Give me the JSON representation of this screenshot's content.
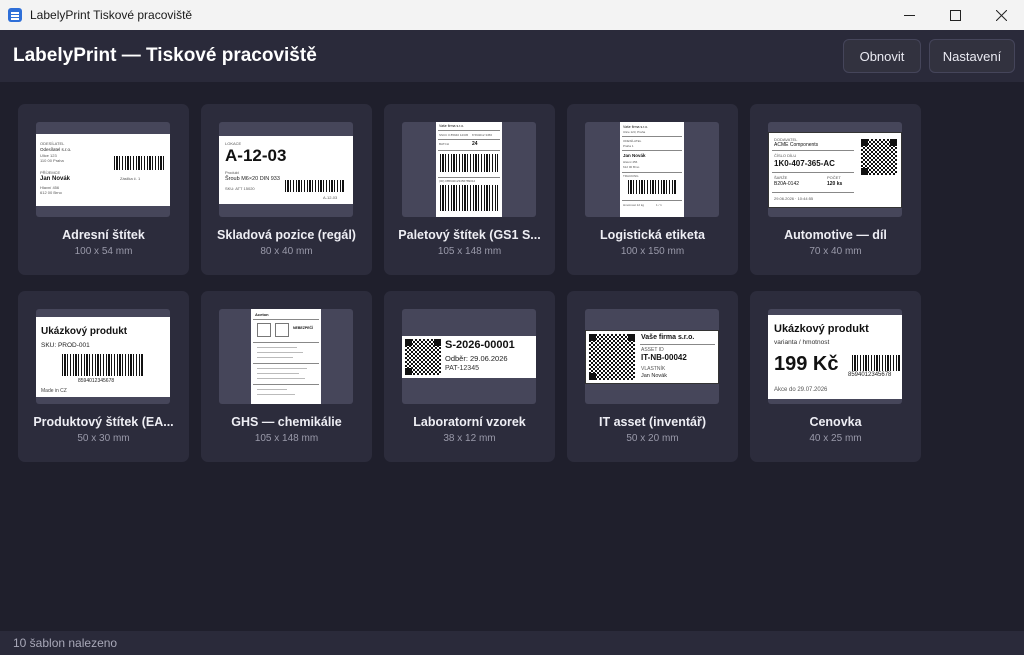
{
  "window": {
    "title": "LabelyPrint Tiskové pracoviště"
  },
  "header": {
    "title": "LabelyPrint — Tiskové pracoviště",
    "refresh_label": "Obnovit",
    "settings_label": "Nastavení"
  },
  "templates": [
    {
      "name": "Adresní štítek",
      "size": "100 x 54 mm",
      "preview": {
        "sender_company": "Odesílatel s.r.o.",
        "recipient_name": "Jan Novák"
      }
    },
    {
      "name": "Skladová pozice (regál)",
      "size": "80 x 40 mm",
      "preview": {
        "code": "A-12-03",
        "line": "Šroub M6×20 DIN 933"
      }
    },
    {
      "name": "Paletový štítek (GS1 S...",
      "size": "105 x 148 mm",
      "preview": {
        "qty": "24"
      }
    },
    {
      "name": "Logistická etiketa",
      "size": "100 x 150 mm",
      "preview": {
        "recipient": "Jan Novák"
      }
    },
    {
      "name": "Automotive — díl",
      "size": "70 x 40 mm",
      "preview": {
        "supplier": "ACME Components",
        "part": "1K0-407-365-AC",
        "batch": "B20A-0142",
        "qty": "120 ks"
      }
    },
    {
      "name": "Produktový štítek (EA...",
      "size": "50 x 30 mm",
      "preview": {
        "product": "Ukázkový produkt",
        "sku": "SKU: PROD-001",
        "ean": "8594012345678",
        "origin": "Made in CZ"
      }
    },
    {
      "name": "GHS — chemikálie",
      "size": "105 x 148 mm",
      "preview": {
        "substance": "Aceton",
        "signal": "NEBEZPEČÍ"
      }
    },
    {
      "name": "Laboratorní vzorek",
      "size": "38 x 12 mm",
      "preview": {
        "sample_id": "S-2026-00001",
        "taken": "Odběr: 29.06.2026",
        "patient": "PAT-12345"
      }
    },
    {
      "name": "IT asset (inventář)",
      "size": "50 x 20 mm",
      "preview": {
        "company": "Vaše firma s.r.o.",
        "asset_label": "ASSET ID",
        "asset_id": "IT-NB-00042",
        "owner_label": "VLASTNÍK",
        "owner": "Jan Novák"
      }
    },
    {
      "name": "Cenovka",
      "size": "40 x 25 mm",
      "preview": {
        "product": "Ukázkový produkt",
        "variant": "varianta / hmotnost",
        "price": "199 Kč",
        "ean": "8594012345678",
        "promo": "Akce do 29.07.2026"
      }
    }
  ],
  "status": {
    "text": "10 šablon nalezeno"
  }
}
